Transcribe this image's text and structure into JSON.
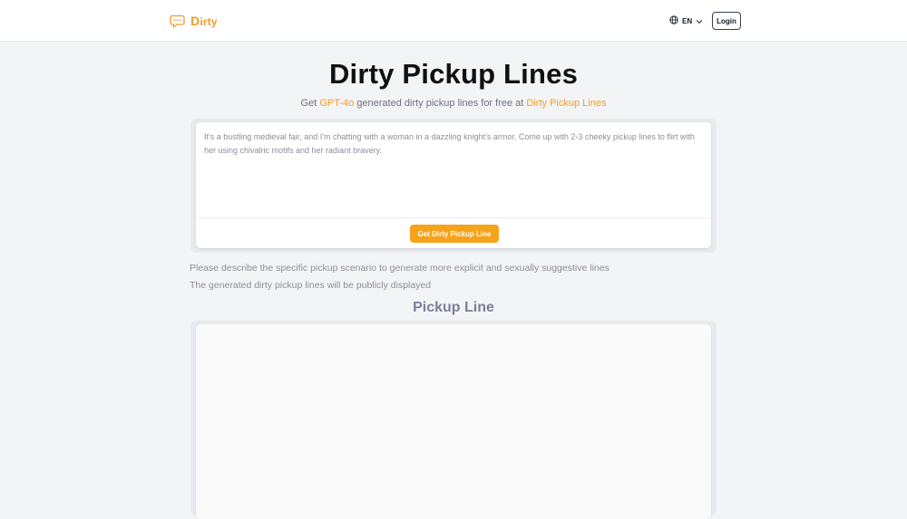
{
  "header": {
    "logo_first": "D",
    "logo_rest": "irty",
    "lang_label": "EN",
    "login_label": "Login"
  },
  "hero": {
    "title": "Dirty Pickup Lines",
    "subtitle_pre": "Get ",
    "subtitle_model": "GPT-4o",
    "subtitle_mid": " generated dirty pickup lines for free at ",
    "subtitle_link": "Dirty Pickup Lines"
  },
  "form": {
    "prompt_value": "It's a bustling medieval fair, and I'm chatting with a woman in a dazzling knight's armor. Come up with 2-3 cheeky pickup lines to flirt with her using chivalric motifs and her radiant bravery.",
    "button_label": "Get Dirty Pickup Line"
  },
  "notes": {
    "line1": "Please describe the specific pickup scenario to generate more explicit and sexually suggestive lines",
    "line2": "The generated dirty pickup lines will be publicly displayed"
  },
  "result": {
    "title": "Pickup Line"
  },
  "icons": {
    "logo": "chat-bubble-icon",
    "lang": "globe-icon",
    "lang_caret": "chevron-down-icon"
  },
  "colors": {
    "accent": "#f39c2b",
    "button": "#f7a21b",
    "background": "#f3f4f6"
  }
}
